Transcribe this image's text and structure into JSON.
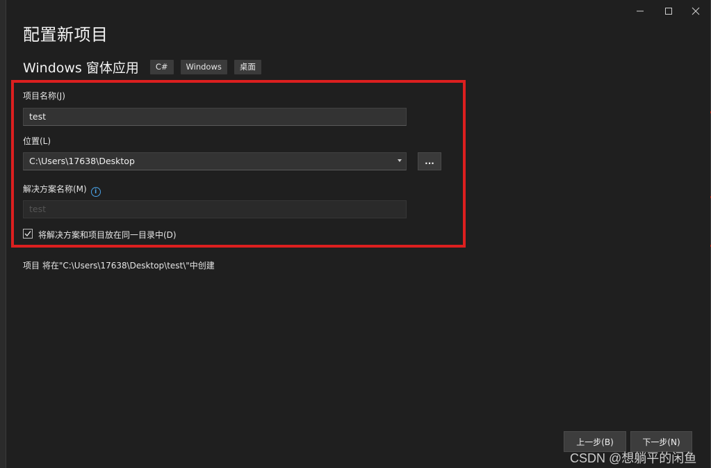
{
  "window": {
    "title": "配置新项目",
    "controls": {
      "minimize_icon": "minimize-icon",
      "maximize_icon": "maximize-icon",
      "close_icon": "close-icon"
    }
  },
  "template": {
    "name": "Windows 窗体应用",
    "tags": [
      "C#",
      "Windows",
      "桌面"
    ]
  },
  "form": {
    "project_name": {
      "label": "项目名称(J)",
      "value": "test"
    },
    "location": {
      "label": "位置(L)",
      "value": "C:\\Users\\17638\\Desktop",
      "browse_label": "..."
    },
    "solution_name": {
      "label": "解决方案名称(M)",
      "placeholder": "test",
      "info_icon": "i"
    },
    "same_directory": {
      "label": "将解决方案和项目放在同一目录中(D)",
      "checked": true
    }
  },
  "path_note": "项目 将在\"C:\\Users\\17638\\Desktop\\test\\\"中创建",
  "footer": {
    "back_label": "上一步(B)",
    "next_label": "下一步(N)"
  },
  "watermark": "CSDN @想躺平的闲鱼",
  "colors": {
    "highlight_border": "#dc1f1f",
    "background": "#1f1f1f",
    "accent_info": "#4aa3e8"
  }
}
